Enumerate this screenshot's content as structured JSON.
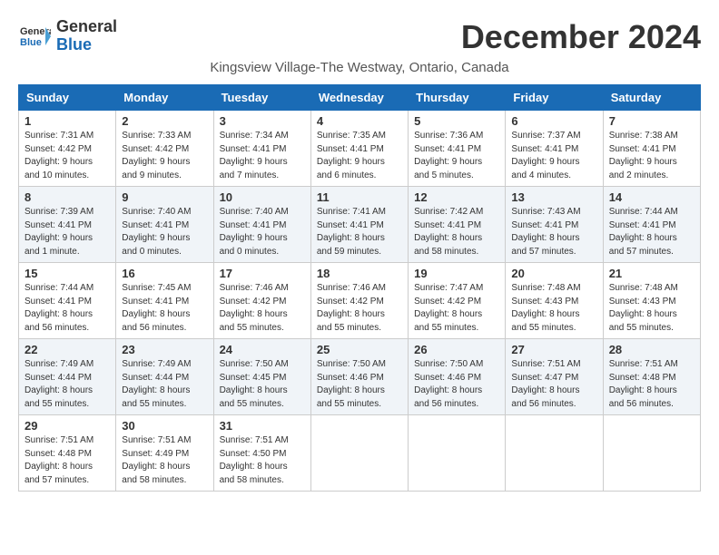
{
  "header": {
    "logo_line1": "General",
    "logo_line2": "Blue",
    "month_title": "December 2024",
    "subtitle": "Kingsview Village-The Westway, Ontario, Canada"
  },
  "days_of_week": [
    "Sunday",
    "Monday",
    "Tuesday",
    "Wednesday",
    "Thursday",
    "Friday",
    "Saturday"
  ],
  "weeks": [
    [
      {
        "day": "1",
        "sunrise": "7:31 AM",
        "sunset": "4:42 PM",
        "daylight": "9 hours and 10 minutes."
      },
      {
        "day": "2",
        "sunrise": "7:33 AM",
        "sunset": "4:42 PM",
        "daylight": "9 hours and 9 minutes."
      },
      {
        "day": "3",
        "sunrise": "7:34 AM",
        "sunset": "4:41 PM",
        "daylight": "9 hours and 7 minutes."
      },
      {
        "day": "4",
        "sunrise": "7:35 AM",
        "sunset": "4:41 PM",
        "daylight": "9 hours and 6 minutes."
      },
      {
        "day": "5",
        "sunrise": "7:36 AM",
        "sunset": "4:41 PM",
        "daylight": "9 hours and 5 minutes."
      },
      {
        "day": "6",
        "sunrise": "7:37 AM",
        "sunset": "4:41 PM",
        "daylight": "9 hours and 4 minutes."
      },
      {
        "day": "7",
        "sunrise": "7:38 AM",
        "sunset": "4:41 PM",
        "daylight": "9 hours and 2 minutes."
      }
    ],
    [
      {
        "day": "8",
        "sunrise": "7:39 AM",
        "sunset": "4:41 PM",
        "daylight": "9 hours and 1 minute."
      },
      {
        "day": "9",
        "sunrise": "7:40 AM",
        "sunset": "4:41 PM",
        "daylight": "9 hours and 0 minutes."
      },
      {
        "day": "10",
        "sunrise": "7:40 AM",
        "sunset": "4:41 PM",
        "daylight": "9 hours and 0 minutes."
      },
      {
        "day": "11",
        "sunrise": "7:41 AM",
        "sunset": "4:41 PM",
        "daylight": "8 hours and 59 minutes."
      },
      {
        "day": "12",
        "sunrise": "7:42 AM",
        "sunset": "4:41 PM",
        "daylight": "8 hours and 58 minutes."
      },
      {
        "day": "13",
        "sunrise": "7:43 AM",
        "sunset": "4:41 PM",
        "daylight": "8 hours and 57 minutes."
      },
      {
        "day": "14",
        "sunrise": "7:44 AM",
        "sunset": "4:41 PM",
        "daylight": "8 hours and 57 minutes."
      }
    ],
    [
      {
        "day": "15",
        "sunrise": "7:44 AM",
        "sunset": "4:41 PM",
        "daylight": "8 hours and 56 minutes."
      },
      {
        "day": "16",
        "sunrise": "7:45 AM",
        "sunset": "4:41 PM",
        "daylight": "8 hours and 56 minutes."
      },
      {
        "day": "17",
        "sunrise": "7:46 AM",
        "sunset": "4:42 PM",
        "daylight": "8 hours and 55 minutes."
      },
      {
        "day": "18",
        "sunrise": "7:46 AM",
        "sunset": "4:42 PM",
        "daylight": "8 hours and 55 minutes."
      },
      {
        "day": "19",
        "sunrise": "7:47 AM",
        "sunset": "4:42 PM",
        "daylight": "8 hours and 55 minutes."
      },
      {
        "day": "20",
        "sunrise": "7:48 AM",
        "sunset": "4:43 PM",
        "daylight": "8 hours and 55 minutes."
      },
      {
        "day": "21",
        "sunrise": "7:48 AM",
        "sunset": "4:43 PM",
        "daylight": "8 hours and 55 minutes."
      }
    ],
    [
      {
        "day": "22",
        "sunrise": "7:49 AM",
        "sunset": "4:44 PM",
        "daylight": "8 hours and 55 minutes."
      },
      {
        "day": "23",
        "sunrise": "7:49 AM",
        "sunset": "4:44 PM",
        "daylight": "8 hours and 55 minutes."
      },
      {
        "day": "24",
        "sunrise": "7:50 AM",
        "sunset": "4:45 PM",
        "daylight": "8 hours and 55 minutes."
      },
      {
        "day": "25",
        "sunrise": "7:50 AM",
        "sunset": "4:46 PM",
        "daylight": "8 hours and 55 minutes."
      },
      {
        "day": "26",
        "sunrise": "7:50 AM",
        "sunset": "4:46 PM",
        "daylight": "8 hours and 56 minutes."
      },
      {
        "day": "27",
        "sunrise": "7:51 AM",
        "sunset": "4:47 PM",
        "daylight": "8 hours and 56 minutes."
      },
      {
        "day": "28",
        "sunrise": "7:51 AM",
        "sunset": "4:48 PM",
        "daylight": "8 hours and 56 minutes."
      }
    ],
    [
      {
        "day": "29",
        "sunrise": "7:51 AM",
        "sunset": "4:48 PM",
        "daylight": "8 hours and 57 minutes."
      },
      {
        "day": "30",
        "sunrise": "7:51 AM",
        "sunset": "4:49 PM",
        "daylight": "8 hours and 58 minutes."
      },
      {
        "day": "31",
        "sunrise": "7:51 AM",
        "sunset": "4:50 PM",
        "daylight": "8 hours and 58 minutes."
      },
      null,
      null,
      null,
      null
    ]
  ]
}
